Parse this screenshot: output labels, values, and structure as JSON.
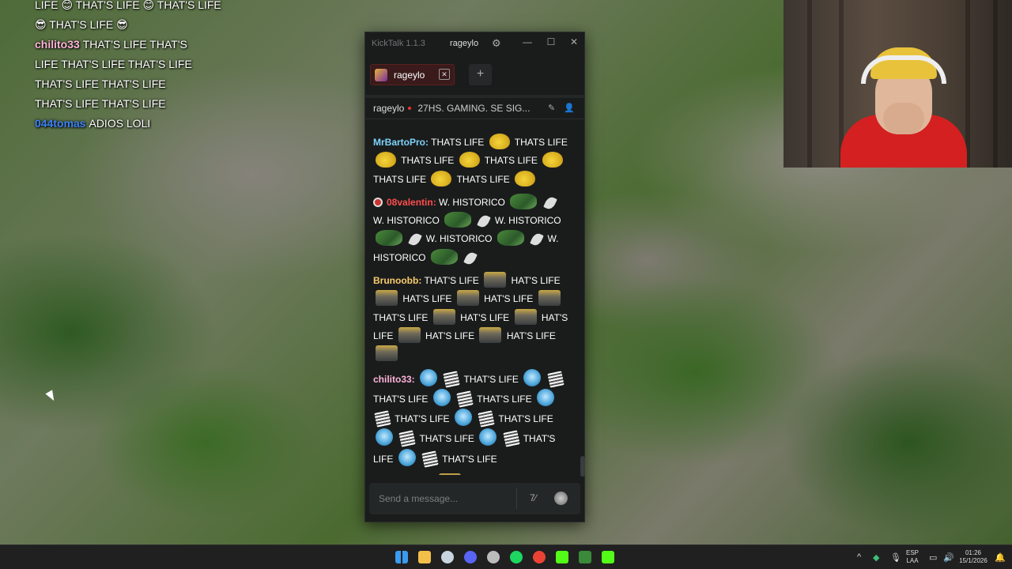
{
  "overlay": {
    "lines": [
      {
        "user": "",
        "user_color": "",
        "text": "LIFE 😊 THAT'S LIFE 😊 THAT'S LIFE"
      },
      {
        "user": "",
        "user_color": "",
        "text": "😎 THAT'S LIFE 😎"
      },
      {
        "user": "chilito33",
        "user_color": "#ffb3d9",
        "text": "THAT'S LIFE THAT'S"
      },
      {
        "user": "",
        "user_color": "",
        "text": "LIFE THAT'S LIFE THAT'S LIFE"
      },
      {
        "user": "",
        "user_color": "",
        "text": "THAT'S LIFE THAT'S LIFE"
      },
      {
        "user": "",
        "user_color": "",
        "text": "THAT'S LIFE THAT'S LIFE"
      },
      {
        "user": "044tomas",
        "user_color": "#3b82f6",
        "text": "ADIOS LOLI"
      }
    ]
  },
  "window": {
    "app_title": "KickTalk 1.1.3",
    "channel_name": "rageylo",
    "colors": {
      "bg": "#1a1c1c",
      "tab_bg": "#3a1a1a",
      "accent_red": "#e33"
    }
  },
  "tabs": [
    {
      "label": "rageylo"
    }
  ],
  "channel_header": {
    "name": "rageylo",
    "stream_title": "27HS. GAMING. SE SIG..."
  },
  "messages": [
    {
      "user": "MrBartoPro:",
      "color": "#7dd3fc",
      "badge": false,
      "parts": [
        [
          "t",
          "THATS LIFE"
        ],
        [
          "e",
          "e-smug"
        ],
        [
          "t",
          "THATS LIFE"
        ],
        [
          "e",
          "e-smug"
        ],
        [
          "t",
          "THATS LIFE"
        ],
        [
          "e",
          "e-smug"
        ],
        [
          "t",
          "THATS LIFE"
        ],
        [
          "e",
          "e-smug"
        ],
        [
          "t",
          "THATS LIFE"
        ],
        [
          "e",
          "e-smug"
        ],
        [
          "t",
          "THATS LIFE"
        ],
        [
          "e",
          "e-smug"
        ]
      ]
    },
    {
      "user": "08valentin:",
      "color": "#ff4d4d",
      "badge": true,
      "parts": [
        [
          "t",
          "W. HISTORICO"
        ],
        [
          "e",
          "e-frog"
        ],
        [
          "e",
          "e-feather"
        ],
        [
          "t",
          "W. HISTORICO"
        ],
        [
          "e",
          "e-frog"
        ],
        [
          "e",
          "e-feather"
        ],
        [
          "t",
          "W. HISTORICO"
        ],
        [
          "e",
          "e-frog"
        ],
        [
          "e",
          "e-feather"
        ],
        [
          "t",
          "W. HISTORICO"
        ],
        [
          "e",
          "e-frog"
        ],
        [
          "e",
          "e-feather"
        ],
        [
          "t",
          "W. HISTORICO"
        ],
        [
          "e",
          "e-frog"
        ],
        [
          "e",
          "e-feather"
        ]
      ]
    },
    {
      "user": "Brunoobb:",
      "color": "#facc6b",
      "badge": false,
      "parts": [
        [
          "t",
          "THAT'S LIFE"
        ],
        [
          "e",
          "e-glasses"
        ],
        [
          "t",
          "HAT'S LIFE"
        ],
        [
          "e",
          "e-glasses"
        ],
        [
          "t",
          "HAT'S LIFE"
        ],
        [
          "e",
          "e-glasses"
        ],
        [
          "t",
          "HAT'S LIFE"
        ],
        [
          "e",
          "e-glasses"
        ],
        [
          "t",
          "THAT'S LIFE"
        ],
        [
          "e",
          "e-glasses"
        ],
        [
          "t",
          "HAT'S LIFE"
        ],
        [
          "e",
          "e-glasses"
        ],
        [
          "t",
          "HAT'S LIFE"
        ],
        [
          "e",
          "e-glasses"
        ],
        [
          "t",
          "HAT'S LIFE"
        ],
        [
          "e",
          "e-glasses"
        ],
        [
          "t",
          "HAT'S LIFE"
        ],
        [
          "e",
          "e-glasses"
        ]
      ]
    },
    {
      "user": "chilito33:",
      "color": "#ffb3d9",
      "badge": false,
      "parts": [
        [
          "e",
          "e-blue"
        ],
        [
          "e",
          "e-paper"
        ],
        [
          "t",
          "THAT'S LIFE"
        ],
        [
          "e",
          "e-blue"
        ],
        [
          "e",
          "e-paper"
        ],
        [
          "t",
          "THAT'S LIFE"
        ],
        [
          "e",
          "e-blue"
        ],
        [
          "e",
          "e-paper"
        ],
        [
          "t",
          "THAT'S LIFE"
        ],
        [
          "e",
          "e-blue"
        ],
        [
          "e",
          "e-paper"
        ],
        [
          "t",
          "THAT'S LIFE"
        ],
        [
          "e",
          "e-blue"
        ],
        [
          "e",
          "e-paper"
        ],
        [
          "t",
          "THAT'S LIFE"
        ],
        [
          "e",
          "e-blue"
        ],
        [
          "e",
          "e-paper"
        ],
        [
          "t",
          "THAT'S LIFE"
        ],
        [
          "e",
          "e-blue"
        ],
        [
          "e",
          "e-paper"
        ],
        [
          "t",
          "THAT'S LIFE"
        ],
        [
          "e",
          "e-blue"
        ],
        [
          "e",
          "e-paper"
        ],
        [
          "t",
          "THAT'S LIFE"
        ]
      ]
    },
    {
      "user": "044tomas:",
      "color": "#3b82f6",
      "badge": true,
      "parts": [
        [
          "e",
          "e-glasses"
        ],
        [
          "t",
          "DIOS LOLI"
        ]
      ]
    }
  ],
  "composer": {
    "placeholder": "Send a message..."
  },
  "taskbar": {
    "lang_top": "ESP",
    "lang_bottom": "LAA",
    "time": "01:26",
    "date": "15/1/2026",
    "apps": [
      {
        "icon": "windows-start-icon",
        "color": "#3a9bf0"
      },
      {
        "icon": "file-explorer-icon",
        "color": "#f2c04a"
      },
      {
        "icon": "steam-icon",
        "color": "#c7d5e0"
      },
      {
        "icon": "discord-icon",
        "color": "#5865f2"
      },
      {
        "icon": "obs-icon",
        "color": "#bbbbbb"
      },
      {
        "icon": "spotify-icon",
        "color": "#1ed760"
      },
      {
        "icon": "chrome-icon",
        "color": "#ea4335"
      },
      {
        "icon": "kick-icon",
        "color": "#53fc18"
      },
      {
        "icon": "kicktalk-icon",
        "color": "#3a8a3a"
      },
      {
        "icon": "kick-alt-icon",
        "color": "#53fc18"
      }
    ]
  }
}
